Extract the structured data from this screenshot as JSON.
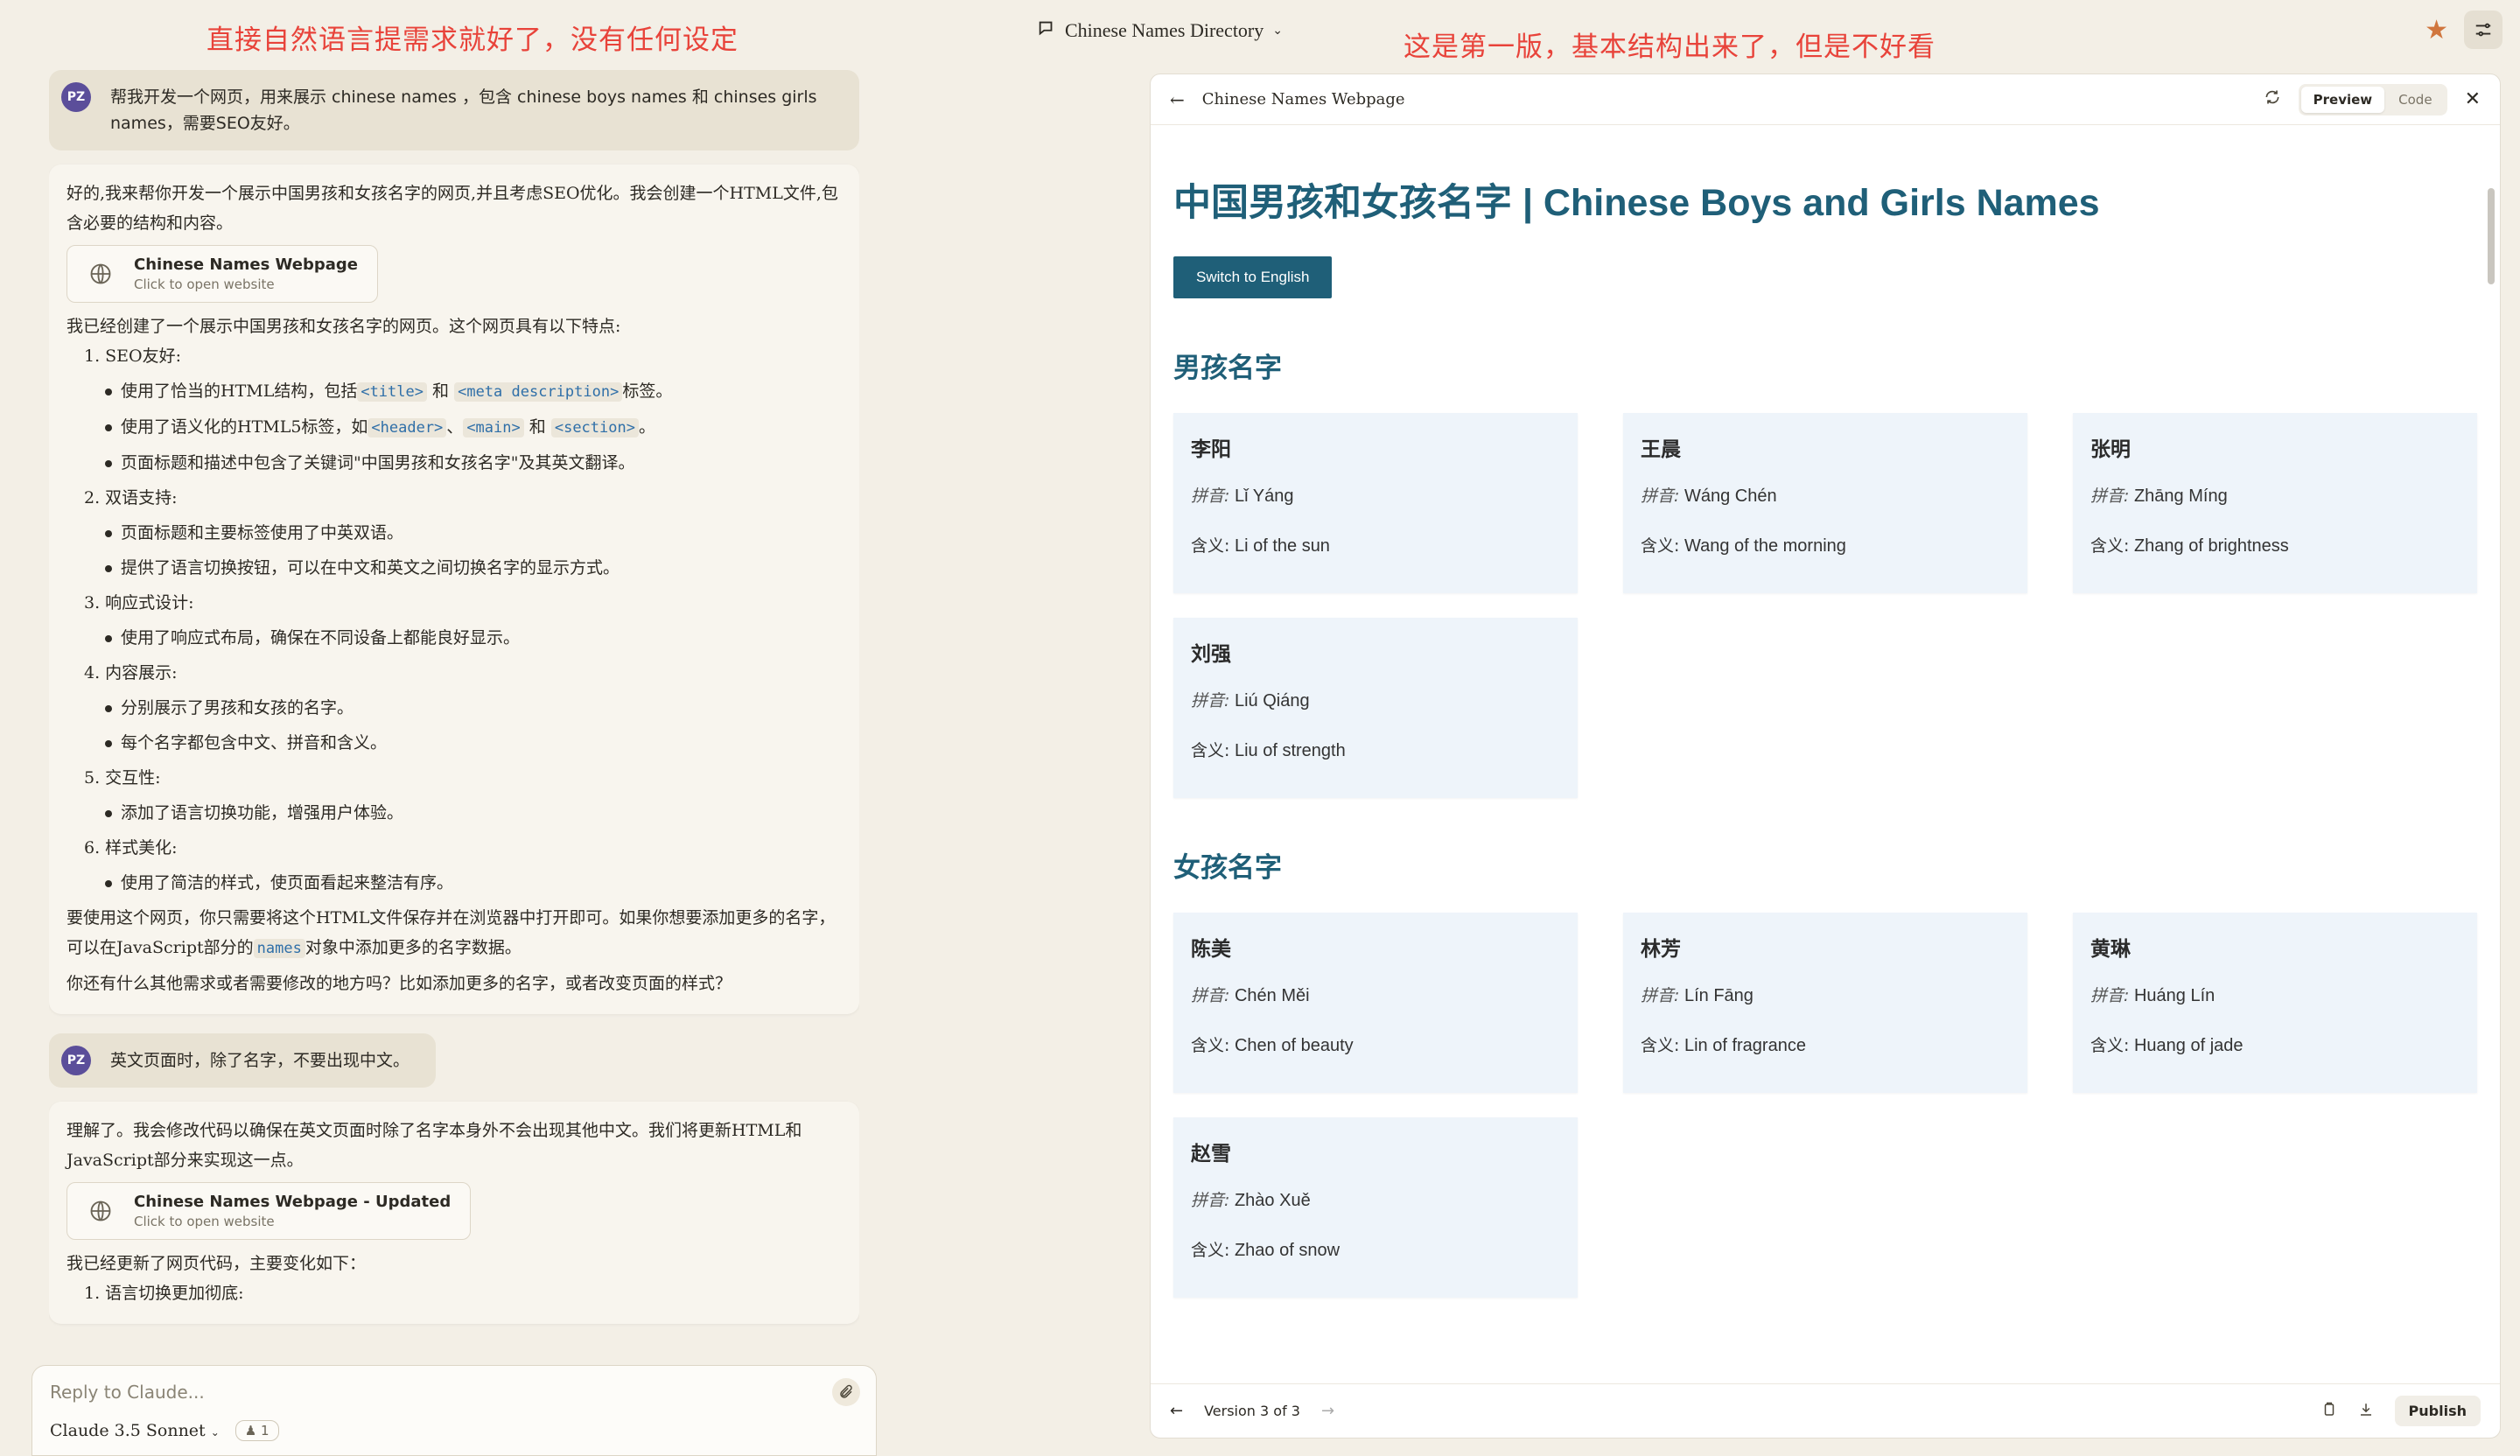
{
  "annotations": {
    "left": "直接自然语言提需求就好了，没有任何设定",
    "right": "这是第一版，基本结构出来了，但是不好看"
  },
  "header": {
    "title": "Chinese Names Directory",
    "accent": "#d0763e"
  },
  "chat": {
    "user_initials": "PZ",
    "msg1": "帮我开发一个网页，用来展示 chinese names ，包含 chinese boys names 和 chinses girls names，需要SEO友好。",
    "reply1_intro": "好的,我来帮你开发一个展示中国男孩和女孩名字的网页,并且考虑SEO优化。我会创建一个HTML文件,包含必要的结构和内容。",
    "card1_title": "Chinese Names Webpage",
    "card1_sub": "Click to open website",
    "reply1_p2": "我已经创建了一个展示中国男孩和女孩名字的网页。这个网页具有以下特点:",
    "s1": "1. SEO友好:",
    "s1_b1_a": "使用了恰当的HTML结构，包括",
    "s1_b1_code1": "<title>",
    "s1_b1_and": "和",
    "s1_b1_code2": "<meta description>",
    "s1_b1_end": "标签。",
    "s1_b2_a": "使用了语义化的HTML5标签，如",
    "s1_b2_code1": "<header>",
    "s1_b2_sep": "、",
    "s1_b2_code2": "<main>",
    "s1_b2_and": "和",
    "s1_b2_code3": "<section>",
    "s1_b2_end": "。",
    "s1_b3": "页面标题和描述中包含了关键词\"中国男孩和女孩名字\"及其英文翻译。",
    "s2": "2. 双语支持:",
    "s2_b1": "页面标题和主要标签使用了中英双语。",
    "s2_b2": "提供了语言切换按钮，可以在中文和英文之间切换名字的显示方式。",
    "s3": "3. 响应式设计:",
    "s3_b1": "使用了响应式布局，确保在不同设备上都能良好显示。",
    "s4": "4. 内容展示:",
    "s4_b1": "分别展示了男孩和女孩的名字。",
    "s4_b2": "每个名字都包含中文、拼音和含义。",
    "s5": "5. 交互性:",
    "s5_b1": "添加了语言切换功能，增强用户体验。",
    "s6": "6. 样式美化:",
    "s6_b1": "使用了简洁的样式，使页面看起来整洁有序。",
    "reply1_p3_a": "要使用这个网页，你只需要将这个HTML文件保存并在浏览器中打开即可。如果你想要添加更多的名字，可以在JavaScript部分的",
    "reply1_p3_code": "names",
    "reply1_p3_b": "对象中添加更多的名字数据。",
    "reply1_p4": "你还有什么其他需求或者需要修改的地方吗？比如添加更多的名字，或者改变页面的样式？",
    "msg2": "英文页面时，除了名字，不要出现中文。",
    "reply2_intro": "理解了。我会修改代码以确保在英文页面时除了名字本身外不会出现其他中文。我们将更新HTML和JavaScript部分来实现这一点。",
    "card2_title": "Chinese Names Webpage - Updated",
    "card2_sub": "Click to open website",
    "reply2_p2": "我已经更新了网页代码，主要变化如下：",
    "reply2_s1": "1. 语言切换更加彻底:",
    "input_placeholder": "Reply to Claude...",
    "model": "Claude 3.5 Sonnet",
    "attach_count": "1"
  },
  "panel": {
    "title": "Chinese Names Webpage",
    "tab_preview": "Preview",
    "tab_code": "Code",
    "page_title": "中国男孩和女孩名字 | Chinese Boys and Girls Names",
    "switch_label": "Switch to English",
    "boys_heading": "男孩名字",
    "girls_heading": "女孩名字",
    "pinyin_label": "拼音:",
    "meaning_label": "含义:",
    "boys": [
      {
        "zh": "李阳",
        "pinyin": "Lǐ Yáng",
        "meaning": "Li of the sun"
      },
      {
        "zh": "王晨",
        "pinyin": "Wáng Chén",
        "meaning": "Wang of the morning"
      },
      {
        "zh": "张明",
        "pinyin": "Zhāng Míng",
        "meaning": "Zhang of brightness"
      },
      {
        "zh": "刘强",
        "pinyin": "Liú Qiáng",
        "meaning": "Liu of strength"
      }
    ],
    "girls": [
      {
        "zh": "陈美",
        "pinyin": "Chén Měi",
        "meaning": "Chen of beauty"
      },
      {
        "zh": "林芳",
        "pinyin": "Lín Fāng",
        "meaning": "Lin of fragrance"
      },
      {
        "zh": "黄琳",
        "pinyin": "Huáng Lín",
        "meaning": "Huang of jade"
      },
      {
        "zh": "赵雪",
        "pinyin": "Zhào Xuě",
        "meaning": "Zhao of snow"
      }
    ],
    "version": "Version 3 of 3",
    "publish": "Publish"
  }
}
